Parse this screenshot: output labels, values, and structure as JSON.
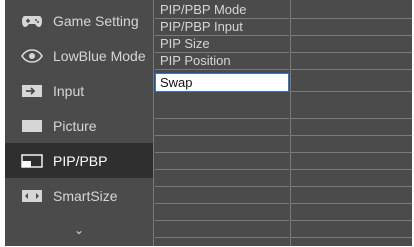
{
  "sidebar": {
    "items": [
      {
        "label": "Game Setting",
        "icon": "gamepad-icon"
      },
      {
        "label": "LowBlue Mode",
        "icon": "eye-icon"
      },
      {
        "label": "Input",
        "icon": "input-arrow-icon"
      },
      {
        "label": "Picture",
        "icon": "picture-icon"
      },
      {
        "label": "PIP/PBP",
        "icon": "pip-icon",
        "active": true
      },
      {
        "label": "SmartSize",
        "icon": "smartsize-icon"
      }
    ],
    "more": "⌄"
  },
  "submenu": {
    "items": [
      "PIP/PBP Mode",
      "PIP/PBP Input",
      "PIP Size",
      "PIP Position",
      "Swap"
    ],
    "selected": "Swap"
  },
  "colors": {
    "background": "#4b4b4b",
    "active": "#2f2f2f",
    "text": "#d6d6d6",
    "highlight_border": "#2a78d6"
  }
}
